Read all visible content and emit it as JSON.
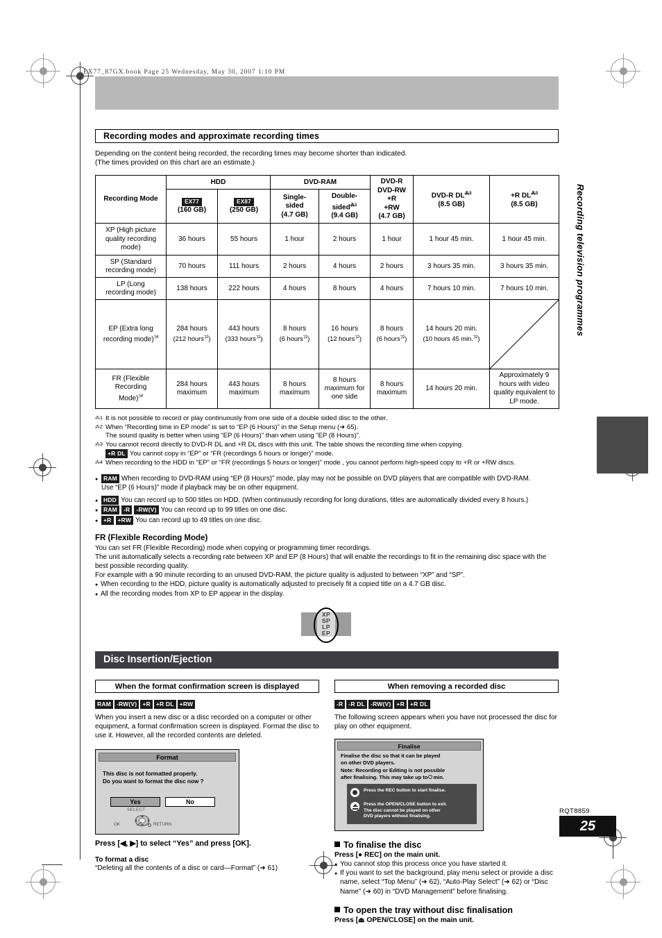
{
  "print": {
    "file_header": "EX77_87GX.book  Page 25  Wednesday, May 30, 2007  1:10 PM",
    "side_tab": "Recording television programmes",
    "rqt_code": "RQT8859",
    "page_number": "25"
  },
  "section": {
    "heading": "Recording modes and approximate recording times",
    "intro_line1": "Depending on the content being recorded, the recording times may become shorter than indicated.",
    "intro_line2": "(The times provided on this chart are an estimate.)"
  },
  "table": {
    "group_headers": {
      "mode": "Recording Mode",
      "hdd": "HDD",
      "dvd_ram": "DVD-RAM",
      "dvd_r": [
        "DVD-R",
        "DVD-RW",
        "+R",
        "+RW",
        "(4.7 GB)"
      ],
      "dvd_r_dl": {
        "label": "DVD-R DL",
        "sup": "3",
        "cap": "(8.5 GB)"
      },
      "plus_r_dl": {
        "label": "+R DL",
        "sup": "3",
        "cap": "(8.5 GB)"
      }
    },
    "sub_headers": {
      "ex77_chip": "EX77",
      "ex77_cap": "(160 GB)",
      "ex87_chip": "EX87",
      "ex87_cap": "(250 GB)",
      "single_sided": [
        "Single-",
        "sided",
        "(4.7 GB)"
      ],
      "double_sided": {
        "l1": "Double-",
        "l2": "sided",
        "sup": "1",
        "l3": "(9.4 GB)"
      }
    },
    "rows": [
      {
        "mode_lines": [
          "XP (High picture",
          "quality recording",
          "mode)"
        ],
        "mode_sup": "",
        "cells": [
          "36 hours",
          "55 hours",
          "1 hour",
          "2 hours",
          "1 hour",
          "1 hour 45 min.",
          "1 hour 45 min."
        ]
      },
      {
        "mode_lines": [
          "SP (Standard",
          "recording mode)"
        ],
        "mode_sup": "",
        "cells": [
          "70 hours",
          "111 hours",
          "2 hours",
          "4 hours",
          "2 hours",
          "3 hours 35 min.",
          "3 hours 35 min."
        ]
      },
      {
        "mode_lines": [
          "LP (Long",
          "recording mode)"
        ],
        "mode_sup": "",
        "cells": [
          "138 hours",
          "222 hours",
          "4 hours",
          "8 hours",
          "4 hours",
          "7 hours 10 min.",
          "7 hours 10 min."
        ]
      },
      {
        "mode_lines": [
          "EP (Extra long",
          "recording mode)"
        ],
        "mode_sup": "4",
        "cells": [
          "284 hours|(212 hours|2|)",
          "443 hours|(333 hours|2|)",
          "8 hours|(6 hours|2|)",
          "16 hours|(12 hours|2|)",
          "8 hours|(6 hours|2|)",
          "14 hours 20 min.|(10 hours 45 min.|2|)",
          "DIAGONAL"
        ]
      },
      {
        "mode_lines": [
          "FR (Flexible",
          "Recording",
          "Mode)"
        ],
        "mode_sup": "4",
        "cells": [
          "284 hours maximum",
          "443 hours maximum",
          "8 hours maximum",
          "8 hours maximum for one side",
          "8 hours maximum",
          "14 hours 20 min.",
          "Approximately 9 hours with video quality equivalent to LP mode."
        ]
      }
    ]
  },
  "footnotes": [
    {
      "mark": "1",
      "lines": [
        "It is not possible to record or play continuously from one side of a double sided disc to the other."
      ]
    },
    {
      "mark": "2",
      "lines": [
        "When “Recording time in EP mode” is set to “EP (6 Hours)” in the Setup menu (➜ 65).",
        "The sound quality is better when using “EP (6 Hours)” than when using “EP (8 Hours)”."
      ]
    },
    {
      "mark": "3",
      "lines": [
        "You cannot record directly to DVD-R DL and +R DL discs with this unit. The table shows the recording time when copying."
      ],
      "chip": "+R DL",
      "chip_text": "You cannot copy in “EP” or “FR (recordings 5 hours or longer)” mode."
    },
    {
      "mark": "4",
      "lines": [
        "When recording to the HDD in “EP” or “FR (recordings 5 hours or longer)” mode , you cannot perform high-speed copy to +R or +RW discs."
      ]
    }
  ],
  "bullet_notes": [
    {
      "chips": [
        "RAM"
      ],
      "text": "When recording to DVD-RAM using “EP (8 Hours)” mode, play may not be possible on DVD players that are compatible with DVD-RAM.",
      "text2": "Use “EP (6 Hours)” mode if playback may be on other equipment."
    },
    {
      "chips": [
        "HDD"
      ],
      "text": "You can record up to 500 titles on HDD. (When continuously recording for long durations, titles are automatically divided every 8 hours.)"
    },
    {
      "chips": [
        "RAM",
        "-R",
        "-RW(V)"
      ],
      "text": "You can record up to 99 titles on one disc."
    },
    {
      "chips": [
        "+R",
        "+RW"
      ],
      "text": "You can record up to 49 titles on one disc."
    }
  ],
  "fr_block": {
    "title": "FR (Flexible Recording Mode)",
    "lines": [
      "You can set FR (Flexible Recording) mode when copying or programming timer recordings.",
      "The unit automatically selects a recording rate between XP and EP (8 Hours) that will enable the recordings to fit in the remaining disc space with the best possible recording quality.",
      "For example with a 90 minute recording to an unused DVD-RAM, the picture quality is adjusted to between “XP” and “SP”."
    ],
    "bullets": [
      "When recording to the HDD, picture quality is automatically adjusted to precisely fit a copied title on a 4.7 GB disc.",
      "All the recording modes from XP to EP appear in the display."
    ],
    "display_modes": [
      "XP",
      "SP",
      "LP",
      "EP"
    ]
  },
  "disc_section": {
    "bar_title": "Disc Insertion/Ejection",
    "left": {
      "box_heading": "When the format confirmation screen is displayed",
      "chips": [
        "RAM",
        "-RW(V)",
        "+R",
        "+R DL",
        "+RW"
      ],
      "body": "When you insert a new disc or a disc recorded on a computer or other equipment, a format confirmation screen is displayed. Format the disc to use it. However, all the recorded contents are deleted.",
      "osd": {
        "title": "Format",
        "msg_l1": "This disc is not formatted properly.",
        "msg_l2": "Do you want to format the disc now ?",
        "yes": "Yes",
        "no": "No",
        "select_label": "SELECT",
        "ok_label": "OK",
        "return_label": "RETURN"
      },
      "press_line": "Press [◀, ▶] to select “Yes” and press [OK].",
      "sub_heading": "To format a disc",
      "sub_text": "“Deleting all the contents of a disc or card—Format” (➜ 61)"
    },
    "right": {
      "box_heading": "When removing a recorded disc",
      "chips": [
        "-R",
        "-R DL",
        "-RW(V)",
        "+R",
        "+R DL"
      ],
      "body": "The following screen appears when you have not processed the disc for play on other equipment.",
      "osd": {
        "title": "Finalise",
        "msg_l1": "Finalise the disc so that it can be played",
        "msg_l2": "on other DVD players.",
        "msg_l3": "Note: Recording or Editing is not possible",
        "msg_l4a": "after finalising. This may take up to",
        "msg_l4b": "min.",
        "rec_text": "Press the REC button to start finalise.",
        "eject_l1": "Press the OPEN/CLOSE button to exit.",
        "eject_l2": "The disc cannot be played on other",
        "eject_l3": "DVD players without finalising."
      },
      "heading1": "To finalise the disc",
      "press1": "Press [● REC] on the main unit.",
      "bullets1": [
        "You cannot stop this process once you have started it.",
        "If you want to set the background, play menu select or provide a disc name, select “Top Menu” (➜ 62), “Auto-Play Select” (➜ 62) or “Disc Name” (➜ 60) in “DVD Management” before finalising."
      ],
      "heading2": "To open the tray without disc finalisation",
      "press2": "Press [⏏ OPEN/CLOSE] on the main unit."
    }
  }
}
